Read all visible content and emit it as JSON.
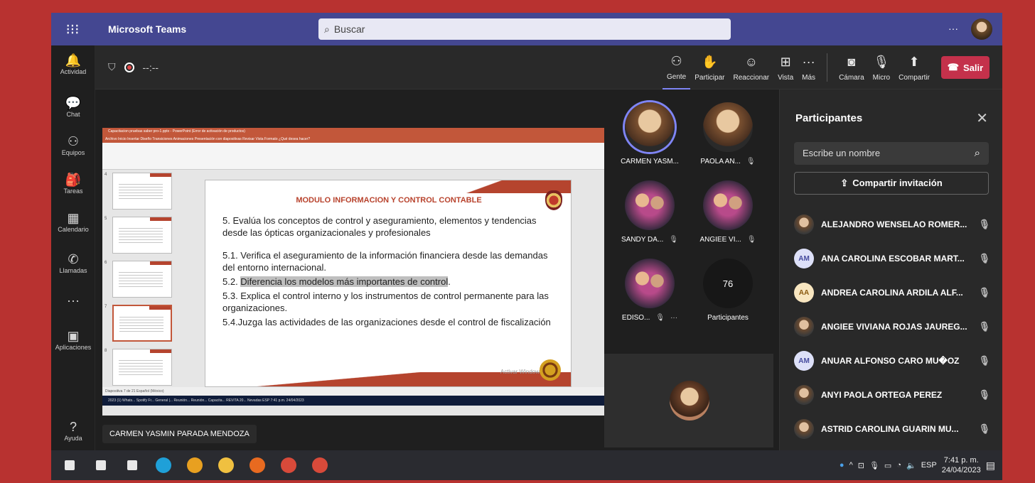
{
  "titlebar": {
    "app_name": "Microsoft Teams",
    "search_placeholder": "Buscar",
    "more": "···"
  },
  "rail": [
    {
      "label": "Actividad",
      "icon": "bell-icon",
      "glyph": "🔔"
    },
    {
      "label": "Chat",
      "icon": "chat-icon",
      "glyph": "💬"
    },
    {
      "label": "Equipos",
      "icon": "teams-icon",
      "glyph": "⚇"
    },
    {
      "label": "Tareas",
      "icon": "tasks-icon",
      "glyph": "🎒"
    },
    {
      "label": "Calendario",
      "icon": "calendar-icon",
      "glyph": "▦"
    },
    {
      "label": "Llamadas",
      "icon": "phone-icon",
      "glyph": "✆"
    },
    {
      "label": "",
      "icon": "more-icon",
      "glyph": "···"
    },
    {
      "label": "Aplicaciones",
      "icon": "apps-icon",
      "glyph": "▣"
    }
  ],
  "help": {
    "label": "Ayuda",
    "icon": "help-icon",
    "glyph": "?"
  },
  "meeting": {
    "timer": "--:--"
  },
  "toolbar": [
    {
      "label": "Gente",
      "icon": "people-icon",
      "glyph": "⚇"
    },
    {
      "label": "Participar",
      "icon": "raise-hand-icon",
      "glyph": "✋"
    },
    {
      "label": "Reaccionar",
      "icon": "react-icon",
      "glyph": "☺"
    },
    {
      "label": "Vista",
      "icon": "view-icon",
      "glyph": "⊞"
    },
    {
      "label": "Más",
      "icon": "more-icon",
      "glyph": "···"
    }
  ],
  "media": [
    {
      "label": "Cámara",
      "icon": "camera-off-icon",
      "glyph": "◙"
    },
    {
      "label": "Micro",
      "icon": "mic-off-icon",
      "glyph": "🎙"
    },
    {
      "label": "Compartir",
      "icon": "share-icon",
      "glyph": "⬆"
    }
  ],
  "leave": {
    "label": "Salir",
    "glyph": "☎"
  },
  "ppt": {
    "window_title": "Capacitacion pruebas saber pro-1.pptx - PowerPoint (Error de activación de productos)",
    "tabs": "Archivo   Inicio   Insertar   Diseño   Transiciones   Animaciones   Presentación con diapositivas   Revisar   Vista   Formato   ¿Qué desea hacer?",
    "slide_title": "MODULO INFORMACION Y CONTROL CONTABLE",
    "lines": [
      "5. Evalúa los conceptos de control y aseguramiento, elementos y tendencias desde las ópticas  organizacionales y profesionales",
      "5.1. Verifica el aseguramiento de la información financiera desde las demandas del entorno internacional.",
      "5.2. ",
      "5.3. Explica el control interno y los instrumentos de control permanente para las organizaciones.",
      "5.4.Juzga las actividades de las organizaciones desde el control de fiscalización"
    ],
    "highlight": "Diferencia los modelos más importantes de control",
    "highlight_end": ".",
    "activate": "Activar Windows",
    "status": "Diapositiva 7 de 21    Español (México)",
    "taskbar_items": "2023    (1) Whats...    Spotify Fr...    General |...    Reunión...    Reunión...    Capacita...    REVITA 20...    Nevadas    ESP   7:41 p.m. 24/04/2023",
    "thumb_numbers": [
      "4",
      "5",
      "6",
      "7",
      "8"
    ]
  },
  "presenter_name": "CARMEN YASMIN PARADA MENDOZA",
  "gallery": [
    {
      "name": "CARMEN YASM...",
      "muted": false
    },
    {
      "name": "PAOLA AN...",
      "muted": true
    },
    {
      "name": "SANDY DA...",
      "muted": true
    },
    {
      "name": "ANGIEE VI...",
      "muted": true
    },
    {
      "name": "EDISO...",
      "muted": true,
      "more": "···"
    }
  ],
  "overflow": {
    "count": "76",
    "label": "Participantes"
  },
  "panel": {
    "title": "Participantes",
    "search_placeholder": "Escribe un nombre",
    "invite": "Compartir invitación",
    "participants": [
      {
        "name": "ALEJANDRO WENSELAO ROMER...",
        "avatar": "photo",
        "initials": ""
      },
      {
        "name": "ANA CAROLINA ESCOBAR MART...",
        "avatar": "ini",
        "initials": "AM"
      },
      {
        "name": "ANDREA CAROLINA ARDILA ALF...",
        "avatar": "ini2",
        "initials": "AA"
      },
      {
        "name": "ANGIEE VIVIANA ROJAS JAUREG...",
        "avatar": "photo",
        "initials": ""
      },
      {
        "name": "ANUAR ALFONSO CARO MU�OZ",
        "avatar": "ini",
        "initials": "AM"
      },
      {
        "name": "ANYI PAOLA ORTEGA PEREZ",
        "avatar": "photo",
        "initials": ""
      },
      {
        "name": "ASTRID CAROLINA GUARIN MU...",
        "avatar": "photo",
        "initials": ""
      }
    ]
  },
  "taskbar": {
    "apps": [
      {
        "icon": "windows-start-icon",
        "color": "#e8e8e8"
      },
      {
        "icon": "search-icon",
        "color": "#e8e8e8"
      },
      {
        "icon": "task-view-icon",
        "color": "#e8e8e8"
      },
      {
        "icon": "edge-icon",
        "color": "#1fa0d8"
      },
      {
        "icon": "chrome-icon",
        "color": "#e8a020"
      },
      {
        "icon": "file-explorer-icon",
        "color": "#f0c040"
      },
      {
        "icon": "firefox-icon",
        "color": "#e86a20"
      },
      {
        "icon": "chrome-profile-icon",
        "color": "#d84a3a"
      },
      {
        "icon": "chrome-profile-icon",
        "color": "#d84a3a"
      }
    ],
    "lang": "ESP",
    "time": "7:41 p. m.",
    "date": "24/04/2023"
  }
}
